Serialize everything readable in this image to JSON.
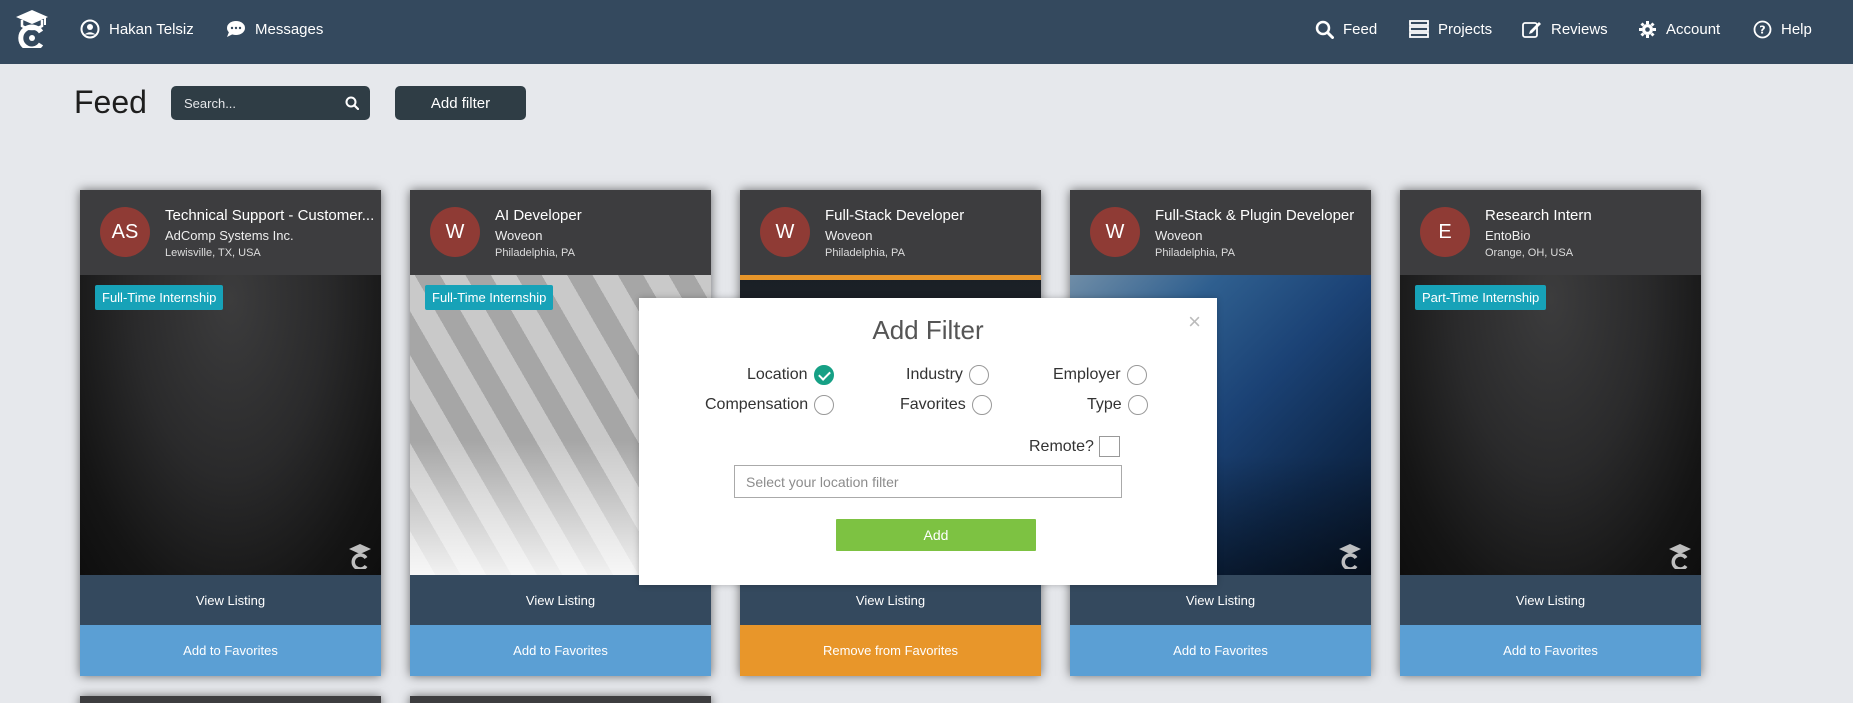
{
  "nav": {
    "user_name": "Hakan Telsiz",
    "messages_label": "Messages",
    "feed_label": "Feed",
    "projects_label": "Projects",
    "reviews_label": "Reviews",
    "account_label": "Account",
    "help_label": "Help"
  },
  "page": {
    "title": "Feed",
    "search_placeholder": "Search...",
    "add_filter_label": "Add filter"
  },
  "cards": [
    {
      "initials": "AS",
      "title": "Technical Support - Customer...",
      "company": "AdComp Systems Inc.",
      "location": "Lewisville, TX, USA",
      "tag": "Full-Time Internship",
      "view_label": "View Listing",
      "fav_label": "Add to Favorites"
    },
    {
      "initials": "W",
      "title": "AI Developer",
      "company": "Woveon",
      "location": "Philadelphia, PA",
      "tag": "Full-Time Internship",
      "view_label": "View Listing",
      "fav_label": "Add to Favorites"
    },
    {
      "initials": "W",
      "title": "Full-Stack Developer",
      "company": "Woveon",
      "location": "Philadelphia, PA",
      "tag": "",
      "view_label": "View Listing",
      "fav_label": "Remove from Favorites"
    },
    {
      "initials": "W",
      "title": "Full-Stack & Plugin Developer",
      "company": "Woveon",
      "location": "Philadelphia, PA",
      "tag": "",
      "view_label": "View Listing",
      "fav_label": "Add to Favorites"
    },
    {
      "initials": "E",
      "title": "Research Intern",
      "company": "EntoBio",
      "location": "Orange, OH, USA",
      "tag": "Part-Time Internship",
      "view_label": "View Listing",
      "fav_label": "Add to Favorites"
    }
  ],
  "modal": {
    "title": "Add Filter",
    "close": "×",
    "options": {
      "location": "Location",
      "industry": "Industry",
      "employer": "Employer",
      "compensation": "Compensation",
      "favorites": "Favorites",
      "type": "Type"
    },
    "selected": "location",
    "remote_label": "Remote?",
    "remote_checked": false,
    "location_placeholder": "Select your location filter",
    "add_label": "Add"
  },
  "colors": {
    "nav_bg": "#34495e",
    "avatar": "#8f3b35",
    "tag": "#17a2b8",
    "view_btn": "#34495e",
    "fav_btn": "#5b9fd4",
    "remove_fav": "#e8962a",
    "add_btn": "#7dc242",
    "checked": "#16a085"
  },
  "icons": {
    "logo": "graduation-cap-logo",
    "user": "user-circle-icon",
    "messages": "chat-bubble-icon",
    "feed": "search-icon",
    "projects": "server-stack-icon",
    "reviews": "edit-square-icon",
    "account": "gear-icon",
    "help": "question-circle-icon"
  }
}
